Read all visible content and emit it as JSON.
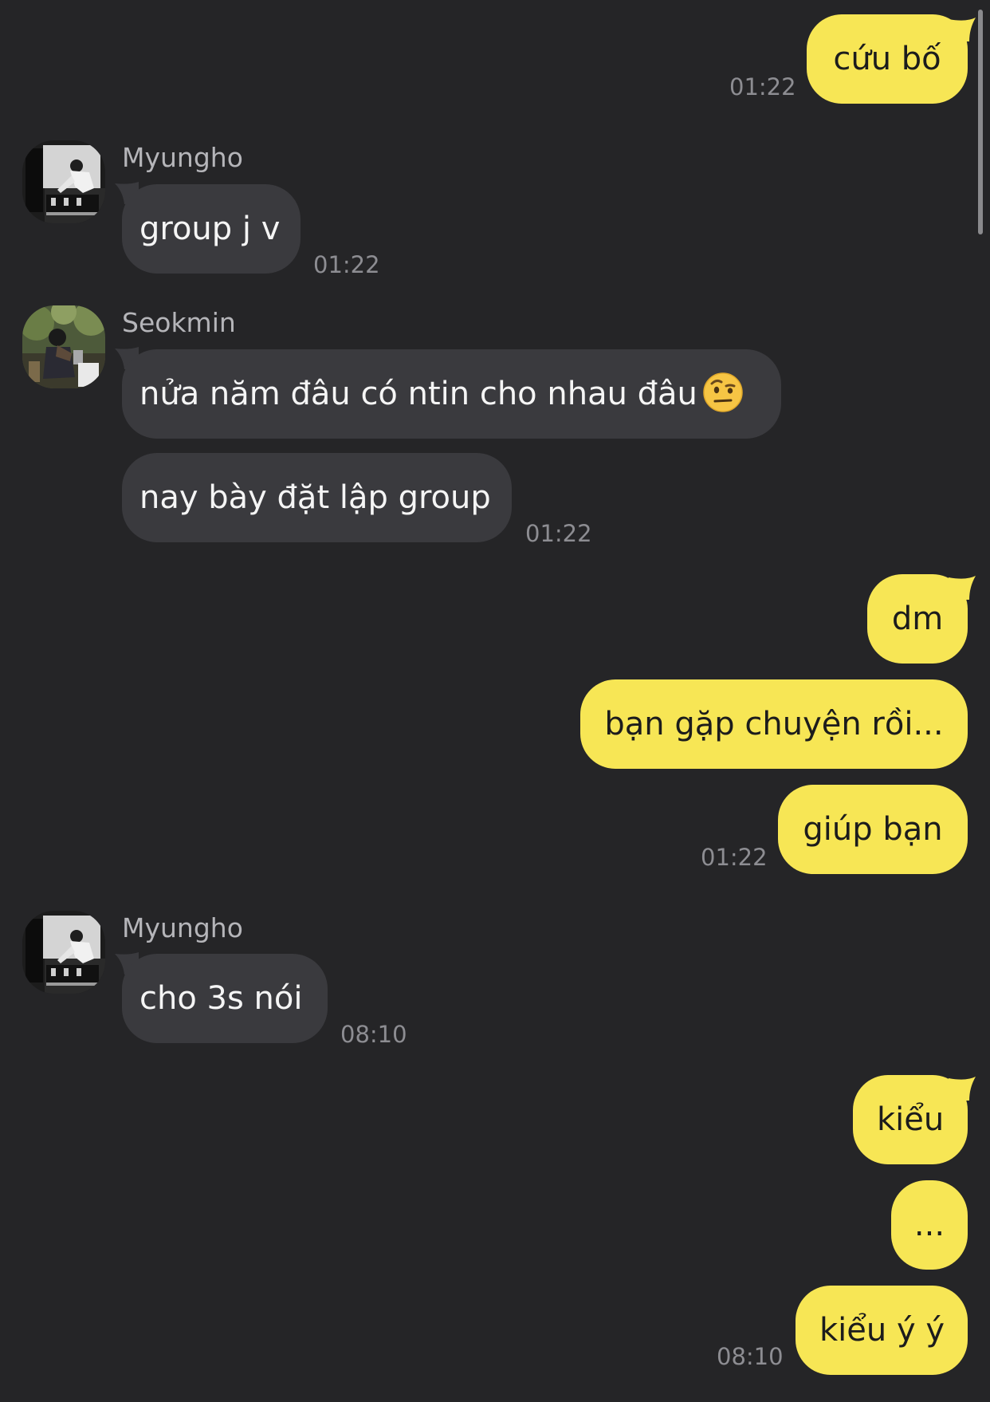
{
  "colors": {
    "background": "#252527",
    "incoming_bubble": "#3a3a3e",
    "outgoing_bubble": "#f7e655",
    "timestamp": "#8d8d92",
    "sender_name": "#b5b5b9"
  },
  "messages": [
    {
      "direction": "outgoing",
      "text": "cứu bố",
      "time": "01:22"
    },
    {
      "direction": "incoming",
      "sender": "Myungho",
      "avatar": "myungho-avatar",
      "text": "group j v",
      "time": "01:22"
    },
    {
      "direction": "incoming",
      "sender": "Seokmin",
      "avatar": "seokmin-avatar",
      "text": "nửa năm đâu có ntin cho nhau đâu",
      "emoji": "face-with-raised-eyebrow-emoji"
    },
    {
      "direction": "incoming",
      "text": "nay bày đặt lập group",
      "time": "01:22"
    },
    {
      "direction": "outgoing",
      "text": "dm"
    },
    {
      "direction": "outgoing",
      "text": "bạn gặp chuyện rồi..."
    },
    {
      "direction": "outgoing",
      "text": "giúp bạn",
      "time": "01:22"
    },
    {
      "direction": "incoming",
      "sender": "Myungho",
      "avatar": "myungho-avatar",
      "text": "cho 3s nói",
      "time": "08:10"
    },
    {
      "direction": "outgoing",
      "text": "kiểu"
    },
    {
      "direction": "outgoing",
      "text": "..."
    },
    {
      "direction": "outgoing",
      "text": "kiểu ý ý",
      "time": "08:10"
    }
  ]
}
